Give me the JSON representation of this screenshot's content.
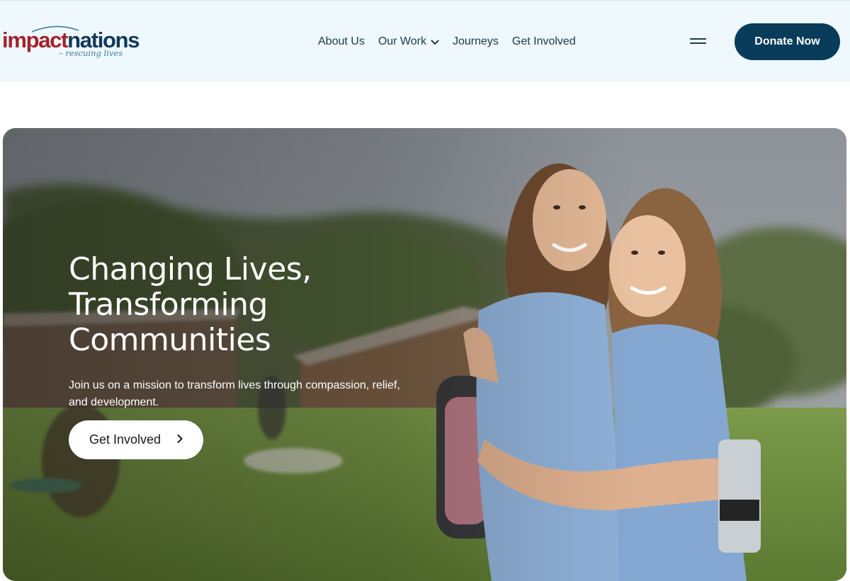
{
  "brand": {
    "name_part1": "impact",
    "name_part2": "nations",
    "tagline": "– rescuing lives"
  },
  "nav": {
    "items": [
      {
        "label": "About Us",
        "has_dropdown": false
      },
      {
        "label": "Our Work",
        "has_dropdown": true
      },
      {
        "label": "Journeys",
        "has_dropdown": false
      },
      {
        "label": "Get Involved",
        "has_dropdown": false
      }
    ]
  },
  "header": {
    "menu_icon": "hamburger-icon",
    "donate_label": "Donate Now"
  },
  "hero": {
    "title_lines": [
      "Changing Lives,",
      "Transforming",
      "Communities"
    ],
    "subtitle": "Join us on a mission to transform lives through compassion, relief, and development.",
    "cta_label": "Get Involved",
    "cta_icon": "chevron-right-icon",
    "image_description_icon": "hero-photo"
  },
  "colors": {
    "header_bg": "#eef8fd",
    "brand_red": "#a3222a",
    "brand_navy": "#11385a",
    "donate_bg": "#083c5a",
    "nav_text": "#1c3a4d"
  }
}
